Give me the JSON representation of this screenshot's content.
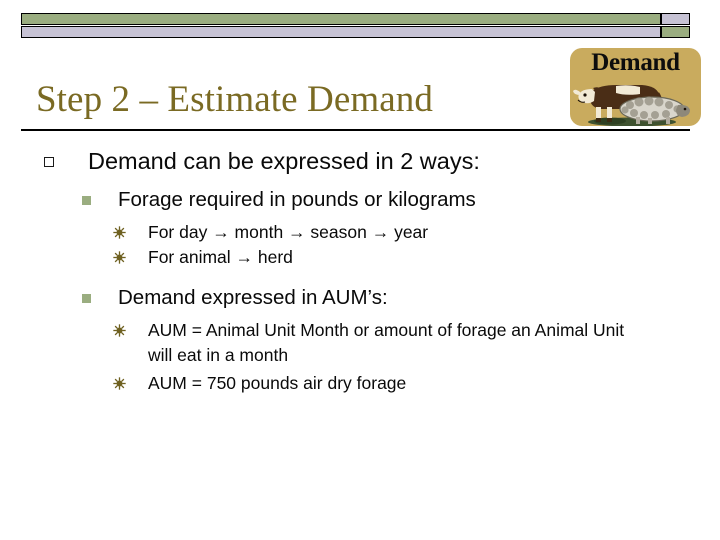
{
  "slide": {
    "title": "Step 2 – Estimate Demand",
    "decor": {
      "bar_green_color": "#9aad80",
      "bar_lavender_color": "#c7c3d5",
      "rule_color": "#000000",
      "title_color": "#7a6a23"
    },
    "clip_art": {
      "caption": "Demand",
      "background_color": "#c9ab5e",
      "depicts": "cow-and-sheep-illustration"
    },
    "bullets": [
      {
        "level": 1,
        "marker": "hollow-square",
        "text": "Demand can be expressed in 2 ways:"
      },
      {
        "level": 2,
        "marker": "filled-green-square",
        "text": "Forage required in pounds or kilograms"
      },
      {
        "level": 3,
        "marker": "olive-starburst",
        "text": "For day →  month → season → year"
      },
      {
        "level": 3,
        "marker": "olive-starburst",
        "text": "For animal → herd"
      },
      {
        "level": 2,
        "marker": "filled-green-square",
        "text": "Demand expressed in AUM’s:"
      },
      {
        "level": 3,
        "marker": "olive-starburst",
        "text": "AUM = Animal Unit Month or amount of forage an Animal Unit will eat in a month"
      },
      {
        "level": 3,
        "marker": "olive-starburst",
        "text": "AUM = 750 pounds air dry forage"
      }
    ]
  }
}
